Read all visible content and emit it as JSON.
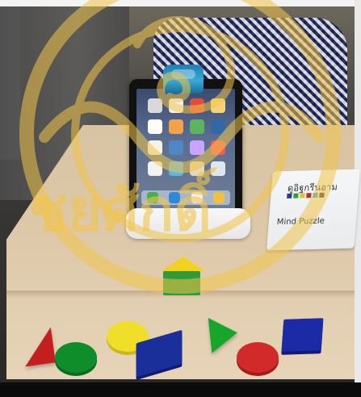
{
  "scene": {
    "description_labels": {
      "booklet_brand": "ดูอิฐกรีนอาม",
      "booklet_title": "Mind Puzzle",
      "watermark_text": "ชยศักดิ์"
    },
    "colors": {
      "red": "#c41f1f",
      "green": "#0f8d2a",
      "yellow": "#f0df2a",
      "blue": "#1b2f9a",
      "tablet_reflector": "#2a95c7",
      "stand": "#eeeeee",
      "table": "#dcc7a7",
      "watermark_gold": "#f1c54a"
    },
    "icons": {
      "watermark_seal": "seal-watermark-icon"
    }
  }
}
